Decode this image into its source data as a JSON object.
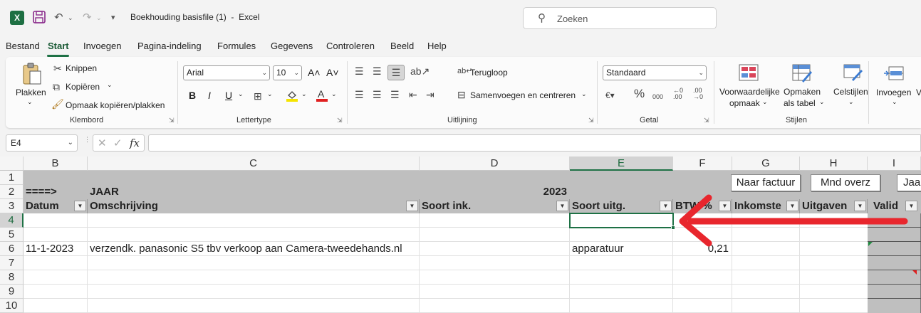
{
  "window": {
    "title": "Boekhouding basisfile (1)  -  Excel"
  },
  "search": {
    "placeholder": "Zoeken"
  },
  "menu": {
    "items": [
      "Bestand",
      "Start",
      "Invoegen",
      "Pagina-indeling",
      "Formules",
      "Gegevens",
      "Controleren",
      "Beeld",
      "Help"
    ],
    "active": "Start"
  },
  "ribbon": {
    "clipboard": {
      "paste": "Plakken",
      "cut": "Knippen",
      "copy": "Kopiëren",
      "format_painter": "Opmaak kopiëren/plakken",
      "label": "Klembord"
    },
    "font": {
      "family": "Arial",
      "size": "10",
      "bold": "B",
      "italic": "I",
      "underline": "U",
      "label": "Lettertype"
    },
    "alignment": {
      "wrap": "Terugloop",
      "merge": "Samenvoegen en centreren",
      "label": "Uitlijning"
    },
    "number": {
      "format": "Standaard",
      "label": "Getal"
    },
    "styles": {
      "conditional_1": "Voorwaardelijke",
      "conditional_2": "opmaak",
      "table_1": "Opmaken",
      "table_2": "als tabel",
      "cell_styles": "Celstijlen",
      "label": "Stijlen"
    },
    "cells": {
      "insert": "Invoegen",
      "partial": "V"
    }
  },
  "formula_bar": {
    "name_box": "E4",
    "fx": "fx",
    "formula": ""
  },
  "grid": {
    "columns": [
      "B",
      "C",
      "D",
      "E",
      "F",
      "G",
      "H",
      "I"
    ],
    "rows": [
      "1",
      "2",
      "3",
      "4",
      "5",
      "6",
      "7",
      "8",
      "9",
      "10"
    ],
    "selected_cell": "E4",
    "row2": {
      "b": "====>",
      "c": "JAAR",
      "d": "2023"
    },
    "headers": {
      "b": "Datum",
      "c": "Omschrijving",
      "d": "Soort ink.",
      "e": "Soort uitg.",
      "f": "BTW %",
      "g": "Inkomste",
      "h": "Uitgaven",
      "i": "Valid"
    },
    "buttons": {
      "factuur": "Naar factuur",
      "mnd": "Mnd overz",
      "jaar": "Jaar"
    },
    "row6": {
      "b": "11-1-2023",
      "c": "verzendk. panasonic S5 tbv verkoop aan Camera-tweedehands.nl",
      "e": "apparatuur",
      "f": "0,21"
    }
  },
  "colors": {
    "accent": "#1e7145",
    "header_fill": "#bfbfbf",
    "arrow": "#e8262d",
    "excel_green": "#1d6f42"
  },
  "icons": [
    "excel-logo-icon",
    "save-icon",
    "undo-icon",
    "redo-icon",
    "customize-icon",
    "search-icon",
    "paste-icon",
    "cut-icon",
    "copy-icon",
    "format-painter-icon"
  ]
}
